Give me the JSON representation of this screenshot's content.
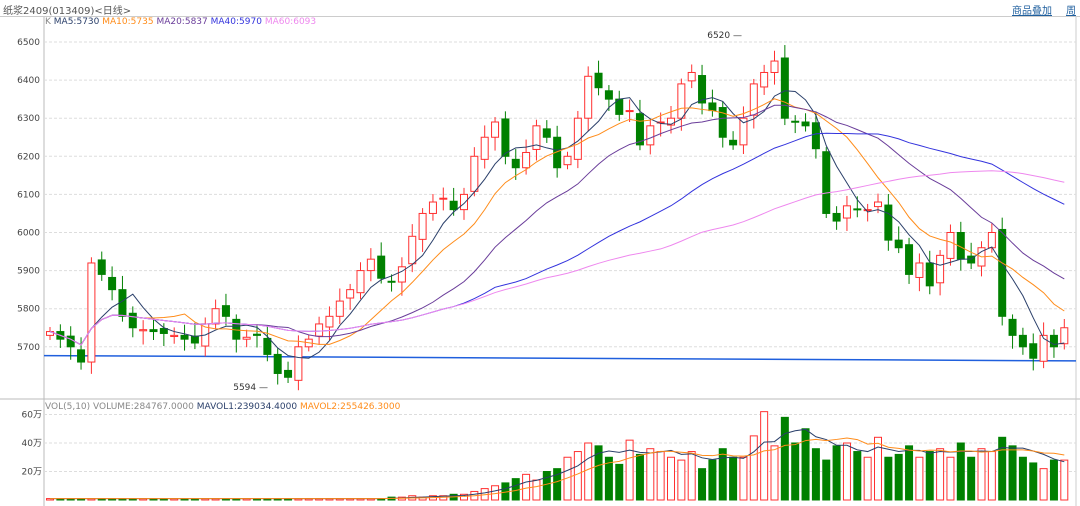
{
  "header": {
    "title": "纸浆2409(013409)<日线>",
    "links": [
      "商品叠加",
      "周"
    ]
  },
  "legend": {
    "k": "K",
    "ma5": "MA5:5730",
    "ma10": "MA10:5735",
    "ma20": "MA20:5837",
    "ma40": "MA40:5970",
    "ma60": "MA60:6093"
  },
  "vol_legend": {
    "name": "VOL(5,10)",
    "volume": "VOLUME:284767.0000",
    "mavol1": "MAVOL1:239034.4000",
    "mavol2": "MAVOL2:255426.3000"
  },
  "colors": {
    "up": "#ff3030",
    "down": "#008000",
    "ma5": "#2a3f6a",
    "ma10": "#ff8c1a",
    "ma20": "#6a3d9a",
    "ma40": "#3333dd",
    "ma60": "#ee88ee",
    "support": "#1f5fdd"
  },
  "chart_data": {
    "type": "candlestick",
    "y_ticks": [
      5700,
      5800,
      5900,
      6000,
      6100,
      6200,
      6300,
      6400,
      6500
    ],
    "vol_ticks": [
      "20万",
      "40万",
      "60万"
    ],
    "annotations": {
      "high": "6520",
      "low": "5594"
    },
    "closes": [
      5740,
      5720,
      5700,
      5660,
      5920,
      5890,
      5850,
      5780,
      5750,
      5745,
      5740,
      5735,
      5730,
      5720,
      5710,
      5760,
      5800,
      5780,
      5720,
      5725,
      5730,
      5680,
      5630,
      5620,
      5700,
      5720,
      5760,
      5780,
      5820,
      5850,
      5900,
      5930,
      5880,
      5870,
      5910,
      5990,
      6050,
      6080,
      6090,
      6060,
      6100,
      6200,
      6250,
      6290,
      6200,
      6170,
      6210,
      6280,
      6250,
      6170,
      6200,
      6300,
      6410,
      6380,
      6350,
      6310,
      6320,
      6230,
      6280,
      6290,
      6300,
      6390,
      6420,
      6340,
      6320,
      6250,
      6230,
      6300,
      6390,
      6420,
      6450,
      6300,
      6290,
      6280,
      6220,
      6050,
      6030,
      6070,
      6060,
      6060,
      6080,
      5980,
      5960,
      5890,
      5920,
      5860,
      5940,
      6000,
      5930,
      5920,
      5960,
      6000,
      5780,
      5730,
      5700,
      5670,
      5730,
      5700,
      5750
    ],
    "volume_wan": [
      1,
      1,
      1,
      1,
      1,
      1,
      1,
      1,
      1,
      1,
      1,
      1,
      1,
      1,
      1,
      1,
      1,
      1,
      1,
      1,
      1,
      1,
      1,
      1,
      1,
      1,
      1,
      1,
      1,
      1,
      1,
      1,
      1,
      2,
      2,
      3,
      2,
      3,
      3,
      4,
      4,
      6,
      8,
      10,
      12,
      15,
      18,
      14,
      20,
      22,
      30,
      34,
      40,
      38,
      30,
      25,
      42,
      32,
      36,
      34,
      30,
      28,
      34,
      22,
      28,
      36,
      30,
      30,
      45,
      62,
      38,
      58,
      40,
      50,
      36,
      28,
      38,
      40,
      34,
      30,
      44,
      30,
      32,
      38,
      30,
      34,
      36,
      30,
      40,
      30,
      36,
      34,
      44,
      38,
      30,
      26,
      22,
      28,
      28
    ]
  }
}
